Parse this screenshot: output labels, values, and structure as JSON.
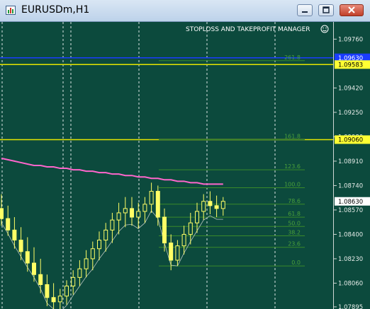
{
  "window": {
    "title": "EURUSDm,H1",
    "buttons": {
      "minimize": "minimize-button",
      "maximize": "maximize-button",
      "close": "close-button"
    }
  },
  "panel": {
    "title": "STOPLOSS AND TAKEPROFIT MANAGER",
    "icon": "smiley-icon"
  },
  "chart_data": {
    "type": "candlestick",
    "symbol": "EURUSDm",
    "timeframe": "H1",
    "ylim": [
      1.0788,
      1.0988
    ],
    "price_ticks": [
      "1.09760",
      "1.09420",
      "1.09250",
      "1.09080",
      "1.08910",
      "1.08740",
      "1.08570",
      "1.08400",
      "1.08230",
      "1.08060",
      "1.07895"
    ],
    "price_labels": [
      {
        "text": "1.09630",
        "kind": "blue-line"
      },
      {
        "text": "1.09583",
        "kind": "yellow-line"
      },
      {
        "text": "1.09060",
        "kind": "yellow-line"
      },
      {
        "text": "1.08630",
        "kind": "current-price"
      }
    ],
    "horizontal_lines": [
      {
        "price": 1.0963,
        "color": "#1a3cff"
      },
      {
        "price": 1.09583,
        "color": "#e6e600"
      },
      {
        "price": 1.0906,
        "color": "#e6e600"
      }
    ],
    "fibonacci": {
      "color": "#3a8a2a",
      "levels": [
        {
          "label": "261.8",
          "price": 1.0961
        },
        {
          "label": "161.8",
          "price": 1.0906
        },
        {
          "label": "123.6",
          "price": 1.0885
        },
        {
          "label": "100.0",
          "price": 1.08725
        },
        {
          "label": "78.6",
          "price": 1.0861
        },
        {
          "label": "61.8",
          "price": 1.0852
        },
        {
          "label": "50.0",
          "price": 1.08455
        },
        {
          "label": "38.2",
          "price": 1.0839
        },
        {
          "label": "23.6",
          "price": 1.0831
        },
        {
          "label": "0.0",
          "price": 1.0818
        }
      ]
    },
    "ohlc": [
      [
        1.0858,
        1.0868,
        1.0846,
        1.0851
      ],
      [
        1.0851,
        1.086,
        1.0839,
        1.0843
      ],
      [
        1.0843,
        1.0852,
        1.083,
        1.0836
      ],
      [
        1.0836,
        1.0845,
        1.0822,
        1.0828
      ],
      [
        1.0828,
        1.0838,
        1.0814,
        1.082
      ],
      [
        1.082,
        1.0831,
        1.0807,
        1.0812
      ],
      [
        1.0812,
        1.0823,
        1.0799,
        1.0805
      ],
      [
        1.0805,
        1.0812,
        1.079,
        1.0796
      ],
      [
        1.0796,
        1.0806,
        1.0788,
        1.0793
      ],
      [
        1.0793,
        1.0802,
        1.0788,
        1.0797
      ],
      [
        1.0797,
        1.0808,
        1.0791,
        1.0804
      ],
      [
        1.0804,
        1.0815,
        1.0798,
        1.081
      ],
      [
        1.081,
        1.0822,
        1.0804,
        1.0816
      ],
      [
        1.0816,
        1.0829,
        1.081,
        1.0823
      ],
      [
        1.0823,
        1.0835,
        1.0815,
        1.083
      ],
      [
        1.083,
        1.0842,
        1.0822,
        1.0836
      ],
      [
        1.0836,
        1.0848,
        1.0828,
        1.0843
      ],
      [
        1.0843,
        1.0855,
        1.0834,
        1.085
      ],
      [
        1.085,
        1.0862,
        1.084,
        1.0855
      ],
      [
        1.0855,
        1.0866,
        1.0845,
        1.0858
      ],
      [
        1.0858,
        1.0866,
        1.0846,
        1.0852
      ],
      [
        1.0852,
        1.0862,
        1.0844,
        1.0856
      ],
      [
        1.0856,
        1.0866,
        1.0848,
        1.0861
      ],
      [
        1.0861,
        1.0876,
        1.0855,
        1.087
      ],
      [
        1.087,
        1.0874,
        1.0846,
        1.0852
      ],
      [
        1.0852,
        1.0858,
        1.0828,
        1.0834
      ],
      [
        1.0834,
        1.084,
        1.0815,
        1.0822
      ],
      [
        1.0822,
        1.0836,
        1.0818,
        1.0832
      ],
      [
        1.0832,
        1.0846,
        1.0826,
        1.084
      ],
      [
        1.084,
        1.0855,
        1.0833,
        1.0848
      ],
      [
        1.0848,
        1.0862,
        1.0841,
        1.0856
      ],
      [
        1.0856,
        1.0868,
        1.085,
        1.0863
      ],
      [
        1.0863,
        1.087,
        1.0854,
        1.086
      ],
      [
        1.086,
        1.0867,
        1.0852,
        1.0858
      ],
      [
        1.0858,
        1.0866,
        1.0853,
        1.0863
      ]
    ],
    "moving_average": [
      1.0893,
      1.0892,
      1.0891,
      1.089,
      1.0889,
      1.0888,
      1.0888,
      1.0887,
      1.0887,
      1.0886,
      1.0886,
      1.0885,
      1.0885,
      1.0884,
      1.0884,
      1.0883,
      1.0883,
      1.0882,
      1.0882,
      1.0881,
      1.0881,
      1.088,
      1.088,
      1.0879,
      1.0879,
      1.0878,
      1.0878,
      1.0877,
      1.0877,
      1.0876,
      1.0876,
      1.0875,
      1.0875,
      1.0875,
      1.0875
    ]
  }
}
